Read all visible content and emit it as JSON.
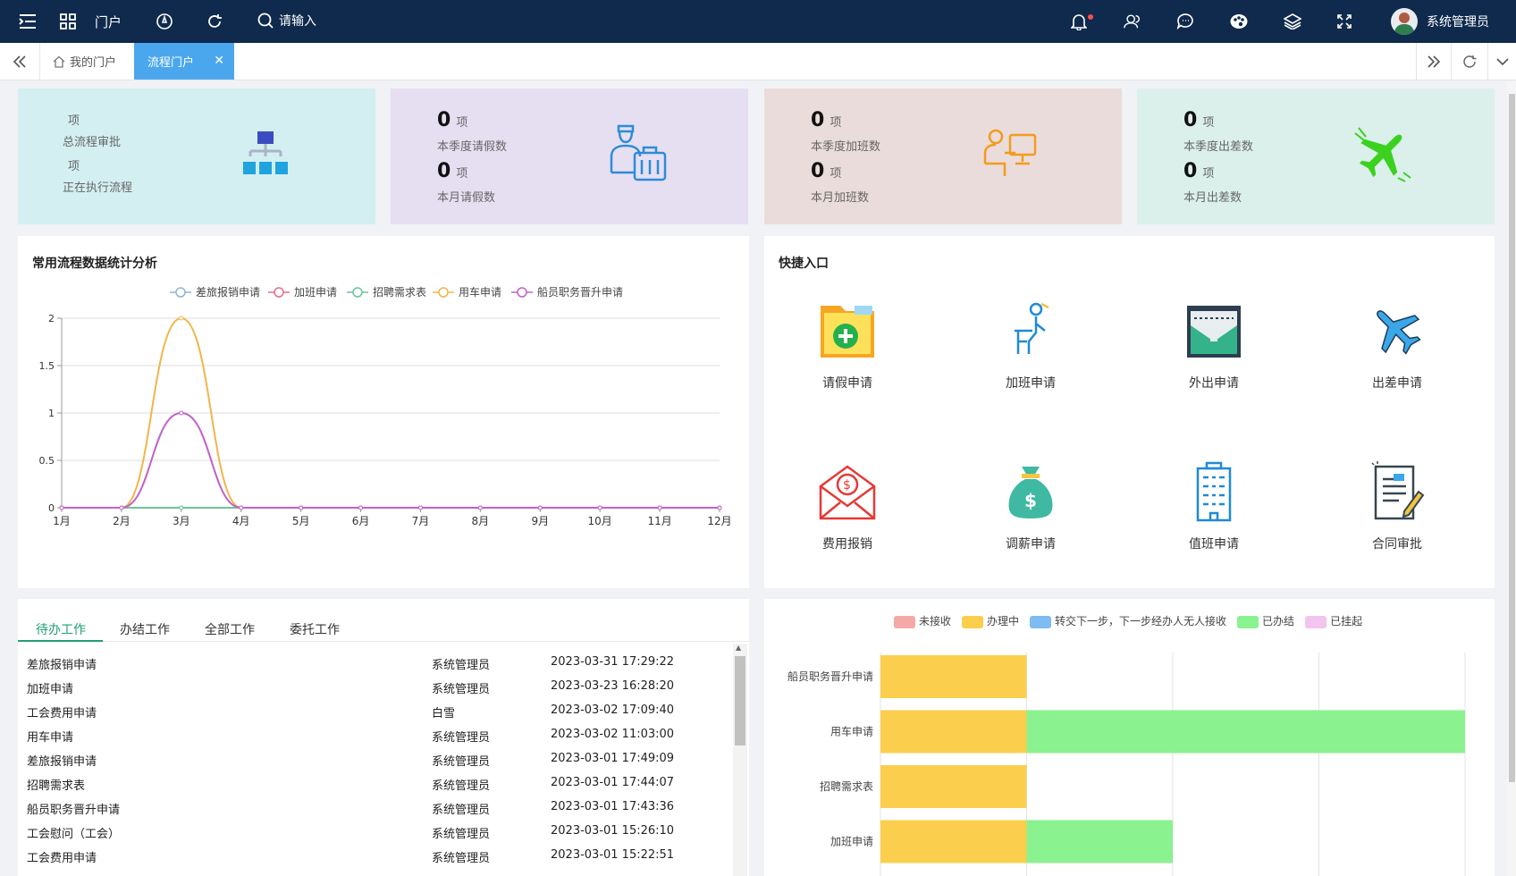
{
  "topbar": {
    "brand": "门户",
    "search_placeholder": "请输入",
    "user_name": "系统管理员"
  },
  "tabs": [
    {
      "label": "我的门户"
    },
    {
      "label": "流程门户"
    }
  ],
  "stats": [
    {
      "v1": "",
      "u1": "项",
      "l1": "总流程审批",
      "v2": "",
      "u2": "项",
      "l2": "正在执行流程",
      "bg": "#d3eff1"
    },
    {
      "v1": "0",
      "u1": "项",
      "l1": "本季度请假数",
      "v2": "0",
      "u2": "项",
      "l2": "本月请假数",
      "bg": "#e6dff2"
    },
    {
      "v1": "0",
      "u1": "项",
      "l1": "本季度加班数",
      "v2": "0",
      "u2": "项",
      "l2": "本月加班数",
      "bg": "#eadcda"
    },
    {
      "v1": "0",
      "u1": "项",
      "l1": "本季度出差数",
      "v2": "0",
      "u2": "项",
      "l2": "本月出差数",
      "bg": "#dbf0ea"
    }
  ],
  "line_card": {
    "title": "常用流程数据统计分析"
  },
  "quick": {
    "title": "快捷入口",
    "items": [
      "请假申请",
      "加班申请",
      "外出申请",
      "出差申请",
      "费用报销",
      "调薪申请",
      "值班申请",
      "合同审批"
    ]
  },
  "work": {
    "tabs": [
      "待办工作",
      "办结工作",
      "全部工作",
      "委托工作"
    ],
    "rows": [
      {
        "name": "差旅报销申请",
        "user": "系统管理员",
        "time": "2023-03-31 17:29:22"
      },
      {
        "name": "加班申请",
        "user": "系统管理员",
        "time": "2023-03-23 16:28:20"
      },
      {
        "name": "工会费用申请",
        "user": "白雪",
        "time": "2023-03-02 17:09:40"
      },
      {
        "name": "用车申请",
        "user": "系统管理员",
        "time": "2023-03-02 11:03:00"
      },
      {
        "name": "差旅报销申请",
        "user": "系统管理员",
        "time": "2023-03-01 17:49:09"
      },
      {
        "name": "招聘需求表",
        "user": "系统管理员",
        "time": "2023-03-01 17:44:07"
      },
      {
        "name": "船员职务晋升申请",
        "user": "系统管理员",
        "time": "2023-03-01 17:43:36"
      },
      {
        "name": "工会慰问（工会）",
        "user": "系统管理员",
        "time": "2023-03-01 15:26:10"
      },
      {
        "name": "工会费用申请",
        "user": "系统管理员",
        "time": "2023-03-01 15:22:51"
      }
    ]
  },
  "chart_data": [
    {
      "type": "line",
      "title": "常用流程数据统计分析",
      "categories": [
        "1月",
        "2月",
        "3月",
        "4月",
        "5月",
        "6月",
        "7月",
        "8月",
        "9月",
        "10月",
        "11月",
        "12月"
      ],
      "ylim": [
        0,
        2
      ],
      "yticks": [
        "0",
        "0.5",
        "1",
        "1.5",
        "2"
      ],
      "legend_position": "top",
      "grid": true,
      "series": [
        {
          "name": "差旅报销申请",
          "color": "#8fb4d6",
          "values": [
            0,
            0,
            0,
            0,
            0,
            0,
            0,
            0,
            0,
            0,
            0,
            0
          ]
        },
        {
          "name": "加班申请",
          "color": "#e26f8a",
          "values": [
            0,
            0,
            0,
            0,
            0,
            0,
            0,
            0,
            0,
            0,
            0,
            0
          ]
        },
        {
          "name": "招聘需求表",
          "color": "#6cc49a",
          "values": [
            0,
            0,
            0,
            0,
            0,
            0,
            0,
            0,
            0,
            0,
            0,
            0
          ]
        },
        {
          "name": "用车申请",
          "color": "#f1b54a",
          "values": [
            0,
            0,
            2,
            0,
            0,
            0,
            0,
            0,
            0,
            0,
            0,
            0
          ]
        },
        {
          "name": "船员职务晋升申请",
          "color": "#c061c8",
          "values": [
            0,
            0,
            1,
            0,
            0,
            0,
            0,
            0,
            0,
            0,
            0,
            0
          ]
        }
      ]
    },
    {
      "type": "bar",
      "orientation": "horizontal",
      "stacked": true,
      "categories": [
        "船员职务晋升申请",
        "用车申请",
        "招聘需求表",
        "加班申请"
      ],
      "xlim": [
        0,
        4
      ],
      "grid": true,
      "legend_position": "top",
      "series": [
        {
          "name": "未接收",
          "color": "#f4a9a8",
          "values": [
            0,
            0,
            0,
            0
          ]
        },
        {
          "name": "办理中",
          "color": "#fbcf4d",
          "values": [
            1,
            1,
            1,
            1
          ]
        },
        {
          "name": "转交下一步，下一步经办人无人接收",
          "color": "#7ebcf1",
          "values": [
            0,
            0,
            0,
            0
          ]
        },
        {
          "name": "已办结",
          "color": "#8af28f",
          "values": [
            0,
            3,
            0,
            1
          ]
        },
        {
          "name": "已挂起",
          "color": "#f2c4ee",
          "values": [
            0,
            0,
            0,
            0
          ]
        }
      ]
    }
  ]
}
